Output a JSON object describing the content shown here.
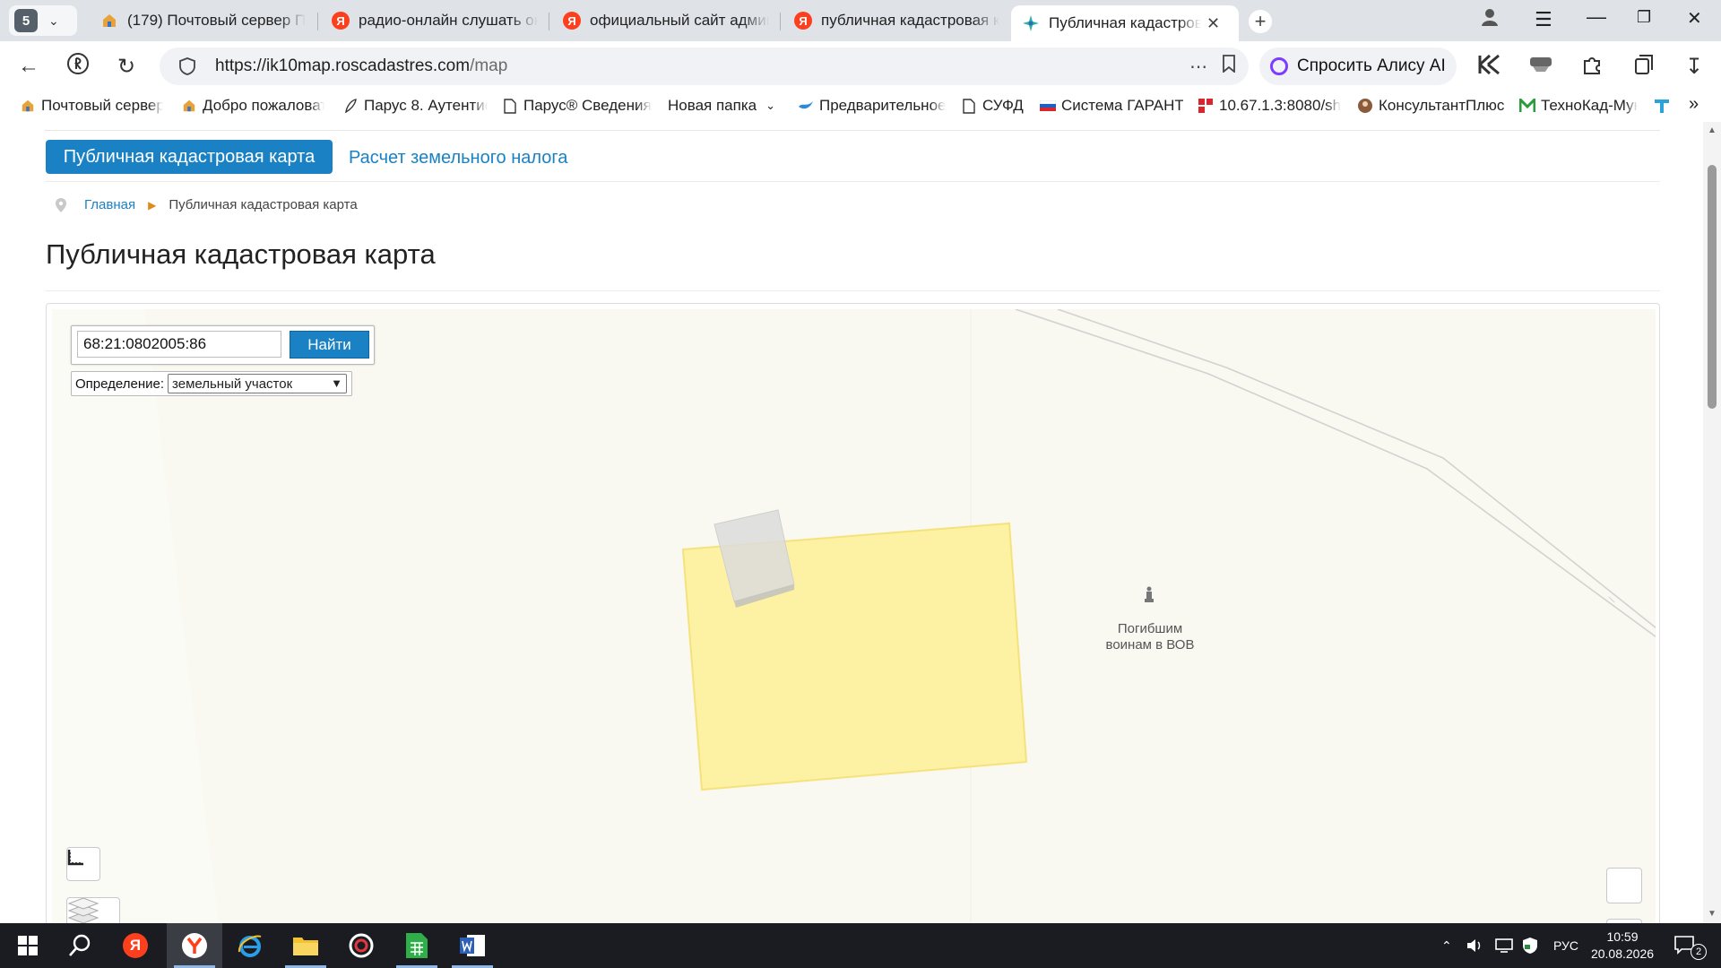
{
  "browser": {
    "tab_count": "5",
    "tabs": [
      {
        "title": "(179) Почтовый сервер П"
      },
      {
        "title": "радио-онлайн слушать он"
      },
      {
        "title": "официальный сайт админ"
      },
      {
        "title": "публичная кадастровая к"
      },
      {
        "title": "Публичная кадастрова"
      }
    ],
    "url_host": "https://ik10map.roscadastres.com",
    "url_path": "/map",
    "alice_label": "Спросить Алису AI",
    "yandex_letter": "Я",
    "bookmarks": [
      {
        "label": "Почтовый сервер"
      },
      {
        "label": "Добро пожаловат"
      },
      {
        "label": "Парус 8. Аутентиф"
      },
      {
        "label": "Парус® Сведения"
      },
      {
        "label": "Новая папка"
      },
      {
        "label": "Предварительное"
      },
      {
        "label": "СУФД"
      },
      {
        "label": "Система ГАРАНТ"
      },
      {
        "label": "10.67.1.3:8080/sh"
      },
      {
        "label": "КонсультантПлюс"
      },
      {
        "label": "ТехноКад-Мун"
      }
    ]
  },
  "page": {
    "nav_active": "Публичная кадастровая карта",
    "nav_link": "Расчет земельного налога",
    "breadcrumb_home": "Главная",
    "breadcrumb_current": "Публичная кадастровая карта",
    "title": "Публичная кадастровая карта",
    "search": {
      "value": "68:21:0802005:86",
      "button_label": "Найти"
    },
    "definition": {
      "label": "Определение:",
      "selected": "земельный участок"
    },
    "map_label_line1": "Погибшим",
    "map_label_line2": "воинам в ВОВ"
  },
  "taskbar": {
    "lang": "РУС",
    "time": "10:59",
    "date": "20.08.2026",
    "notifications": "2"
  },
  "colors": {
    "accent": "#1a82c4",
    "parcel_fill": "#fdf2a4",
    "parcel_stroke": "#f5e27a",
    "map_bg": "#f9f8f1"
  }
}
